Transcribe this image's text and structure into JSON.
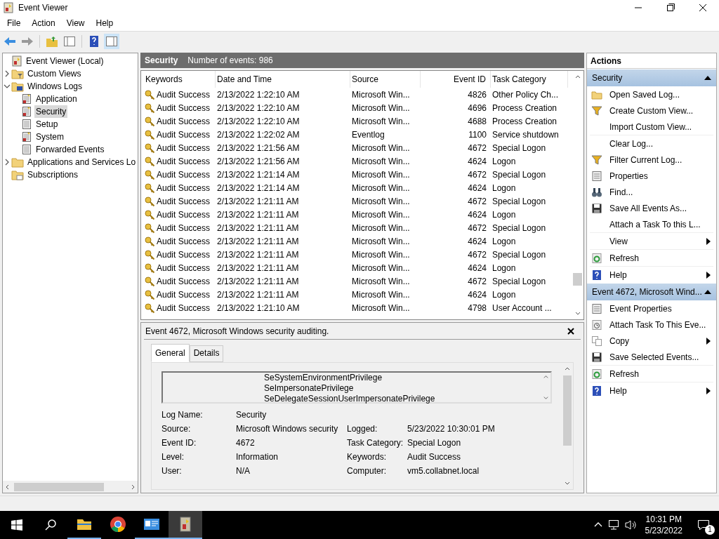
{
  "window": {
    "title": "Event Viewer"
  },
  "menu": [
    "File",
    "Action",
    "View",
    "Help"
  ],
  "toolbar": [
    {
      "kind": "back"
    },
    {
      "kind": "forward"
    },
    {
      "kind": "sep"
    },
    {
      "kind": "folder-up"
    },
    {
      "kind": "pane-left",
      "selected": false
    },
    {
      "kind": "sep"
    },
    {
      "kind": "help"
    },
    {
      "kind": "pane-right",
      "selected": true
    }
  ],
  "tree": [
    {
      "label": "Event Viewer (Local)",
      "kind": "root",
      "selected": false,
      "children": [
        {
          "label": "Custom Views",
          "kind": "folder-filter",
          "expanded": false,
          "selected": false,
          "has_children": true
        },
        {
          "label": "Windows Logs",
          "kind": "folder-logs",
          "expanded": true,
          "selected": false,
          "has_children": true,
          "children": [
            {
              "label": "Application",
              "kind": "log",
              "selected": false
            },
            {
              "label": "Security",
              "kind": "log",
              "selected": true
            },
            {
              "label": "Setup",
              "kind": "log-plain",
              "selected": false
            },
            {
              "label": "System",
              "kind": "log",
              "selected": false
            },
            {
              "label": "Forwarded Events",
              "kind": "log-plain",
              "selected": false
            }
          ]
        },
        {
          "label": "Applications and Services Lo",
          "kind": "folder",
          "expanded": false,
          "selected": false,
          "has_children": true
        },
        {
          "label": "Subscriptions",
          "kind": "folder-sub",
          "selected": false,
          "has_children": false
        }
      ]
    }
  ],
  "log_header": {
    "title": "Security",
    "count": "Number of events: 986"
  },
  "table": {
    "columns": [
      "Keywords",
      "Date and Time",
      "Source",
      "Event ID",
      "Task Category"
    ],
    "rows": [
      [
        "Audit Success",
        "2/13/2022 1:22:10 AM",
        "Microsoft Win...",
        "4826",
        "Other Policy Ch..."
      ],
      [
        "Audit Success",
        "2/13/2022 1:22:10 AM",
        "Microsoft Win...",
        "4696",
        "Process Creation"
      ],
      [
        "Audit Success",
        "2/13/2022 1:22:10 AM",
        "Microsoft Win...",
        "4688",
        "Process Creation"
      ],
      [
        "Audit Success",
        "2/13/2022 1:22:02 AM",
        "Eventlog",
        "1100",
        "Service shutdown"
      ],
      [
        "Audit Success",
        "2/13/2022 1:21:56 AM",
        "Microsoft Win...",
        "4672",
        "Special Logon"
      ],
      [
        "Audit Success",
        "2/13/2022 1:21:56 AM",
        "Microsoft Win...",
        "4624",
        "Logon"
      ],
      [
        "Audit Success",
        "2/13/2022 1:21:14 AM",
        "Microsoft Win...",
        "4672",
        "Special Logon"
      ],
      [
        "Audit Success",
        "2/13/2022 1:21:14 AM",
        "Microsoft Win...",
        "4624",
        "Logon"
      ],
      [
        "Audit Success",
        "2/13/2022 1:21:11 AM",
        "Microsoft Win...",
        "4672",
        "Special Logon"
      ],
      [
        "Audit Success",
        "2/13/2022 1:21:11 AM",
        "Microsoft Win...",
        "4624",
        "Logon"
      ],
      [
        "Audit Success",
        "2/13/2022 1:21:11 AM",
        "Microsoft Win...",
        "4672",
        "Special Logon"
      ],
      [
        "Audit Success",
        "2/13/2022 1:21:11 AM",
        "Microsoft Win...",
        "4624",
        "Logon"
      ],
      [
        "Audit Success",
        "2/13/2022 1:21:11 AM",
        "Microsoft Win...",
        "4672",
        "Special Logon"
      ],
      [
        "Audit Success",
        "2/13/2022 1:21:11 AM",
        "Microsoft Win...",
        "4624",
        "Logon"
      ],
      [
        "Audit Success",
        "2/13/2022 1:21:11 AM",
        "Microsoft Win...",
        "4672",
        "Special Logon"
      ],
      [
        "Audit Success",
        "2/13/2022 1:21:11 AM",
        "Microsoft Win...",
        "4624",
        "Logon"
      ],
      [
        "Audit Success",
        "2/13/2022 1:21:10 AM",
        "Microsoft Win...",
        "4798",
        "User Account ..."
      ]
    ]
  },
  "detail": {
    "title": "Event 4672, Microsoft Windows security auditing.",
    "tabs": [
      {
        "label": "General",
        "selected": true
      },
      {
        "label": "Details",
        "selected": false
      }
    ],
    "description_lines": [
      "SeSystemEnvironmentPrivilege",
      "SeImpersonatePrivilege",
      "SeDelegateSessionUserImpersonatePrivilege"
    ],
    "fields": [
      [
        {
          "label": "Log Name:",
          "value": "Security"
        }
      ],
      [
        {
          "label": "Source:",
          "value": "Microsoft Windows security"
        },
        {
          "label": "Logged:",
          "value": "5/23/2022 10:30:01 PM"
        }
      ],
      [
        {
          "label": "Event ID:",
          "value": "4672"
        },
        {
          "label": "Task Category:",
          "value": "Special Logon"
        }
      ],
      [
        {
          "label": "Level:",
          "value": "Information"
        },
        {
          "label": "Keywords:",
          "value": "Audit Success"
        }
      ],
      [
        {
          "label": "User:",
          "value": "N/A"
        },
        {
          "label": "Computer:",
          "value": "vm5.collabnet.local"
        }
      ]
    ]
  },
  "actions": {
    "title": "Actions",
    "sections": [
      {
        "title": "Security",
        "items": [
          {
            "label": "Open Saved Log...",
            "kind": "folder",
            "divider": false,
            "submenu": false
          },
          {
            "label": "Create Custom View...",
            "kind": "filter",
            "divider": false,
            "submenu": false
          },
          {
            "label": "Import Custom View...",
            "kind": "none",
            "divider": false,
            "submenu": false
          },
          {
            "label": "Clear Log...",
            "kind": "none",
            "divider": true,
            "submenu": false
          },
          {
            "label": "Filter Current Log...",
            "kind": "filter",
            "divider": false,
            "submenu": false
          },
          {
            "label": "Properties",
            "kind": "properties",
            "divider": false,
            "submenu": false
          },
          {
            "label": "Find...",
            "kind": "binoculars",
            "divider": false,
            "submenu": false
          },
          {
            "label": "Save All Events As...",
            "kind": "save",
            "divider": false,
            "submenu": false
          },
          {
            "label": "Attach a Task To this L...",
            "kind": "none",
            "divider": false,
            "submenu": false
          },
          {
            "label": "View",
            "kind": "none",
            "divider": true,
            "submenu": true
          },
          {
            "label": "Refresh",
            "kind": "refresh",
            "divider": true,
            "submenu": false
          },
          {
            "label": "Help",
            "kind": "help",
            "divider": true,
            "submenu": true
          }
        ]
      },
      {
        "title": "Event 4672, Microsoft Wind...",
        "items": [
          {
            "label": "Event Properties",
            "kind": "properties",
            "divider": false,
            "submenu": false
          },
          {
            "label": "Attach Task To This Eve...",
            "kind": "task",
            "divider": false,
            "submenu": false
          },
          {
            "label": "Copy",
            "kind": "copy",
            "divider": false,
            "submenu": true
          },
          {
            "label": "Save Selected Events...",
            "kind": "save",
            "divider": false,
            "submenu": false
          },
          {
            "label": "Refresh",
            "kind": "refresh",
            "divider": true,
            "submenu": false
          },
          {
            "label": "Help",
            "kind": "help",
            "divider": true,
            "submenu": true
          }
        ]
      }
    ]
  },
  "taskbar": {
    "apps": [
      {
        "kind": "explorer",
        "running": true,
        "selected": false
      },
      {
        "kind": "chrome",
        "running": false,
        "selected": false
      },
      {
        "kind": "cards",
        "running": true,
        "selected": false
      },
      {
        "kind": "eventviewer",
        "running": true,
        "selected": true
      }
    ],
    "time": "10:31 PM",
    "date": "5/23/2022",
    "notifications": "1"
  }
}
